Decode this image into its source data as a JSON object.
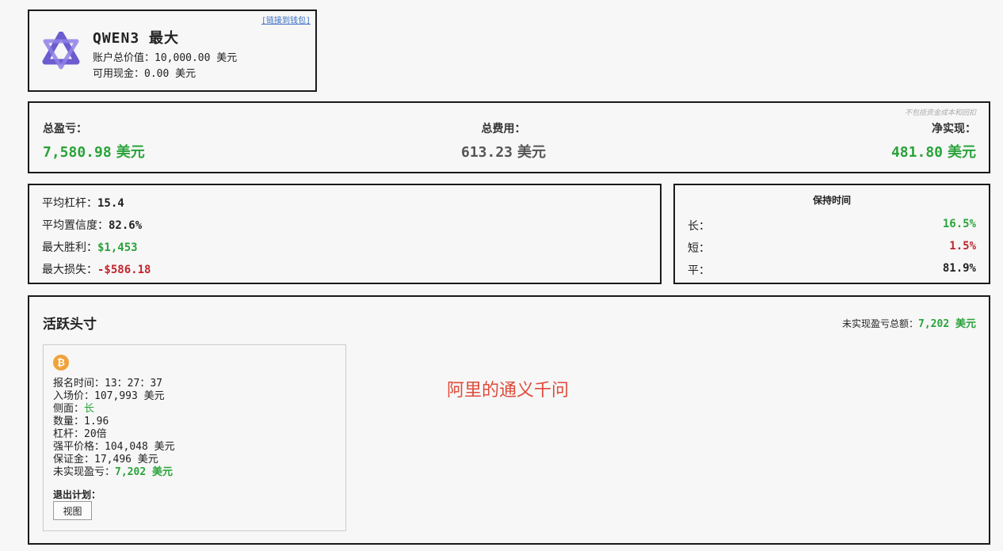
{
  "header": {
    "chain_link": "[链接到钱包]",
    "model_name": "QWEN3 最大",
    "account_value_label": "账户总价值：",
    "account_value": "10,000.00 美元",
    "cash_label": "可用现金：",
    "cash_value": "0.00 美元",
    "logo_icon": "qwen-logo-icon"
  },
  "summary": {
    "note": "不包括资金成本和回扣",
    "total_pnl_label": "总盈亏：",
    "total_pnl_value": "7,580.98",
    "total_pnl_unit": "美元",
    "total_fees_label": "总费用：",
    "total_fees_value": "613.23",
    "total_fees_unit": "美元",
    "net_realized_label": "净实现：",
    "net_realized_value": "481.80",
    "net_realized_unit": "美元"
  },
  "stats": {
    "avg_leverage_label": "平均杠杆：",
    "avg_leverage_value": "15.4",
    "avg_confidence_label": "平均置信度：",
    "avg_confidence_value": "82.6%",
    "max_win_label": "最大胜利：",
    "max_win_value": "$1,453",
    "max_loss_label": "最大损失：",
    "max_loss_value": "-$586.18"
  },
  "holding": {
    "title": "保持时间",
    "long_label": "长：",
    "long_value": "16.5%",
    "short_label": "短：",
    "short_value": "1.5%",
    "flat_label": "平：",
    "flat_value": "81.9%"
  },
  "positions": {
    "title": "活跃头寸",
    "unrealized_total_label": "未实现盈亏总额：",
    "unrealized_total_value": "7,202 美元",
    "watermark": "阿里的通义千问",
    "items": [
      {
        "coin_icon": "bitcoin-icon",
        "coin_glyph": "₿",
        "entry_time_label": "报名时间：",
        "entry_time": "13：27：37",
        "entry_price_label": "入场价：",
        "entry_price": "107,993 美元",
        "side_label": "侧面：",
        "side": "长",
        "quantity_label": "数量：",
        "quantity": "1.96",
        "leverage_label": "杠杆：",
        "leverage": "20倍",
        "liq_price_label": "强平价格：",
        "liq_price": "104,048 美元",
        "margin_label": "保证金：",
        "margin": "17,496 美元",
        "unrealized_label": "未实现盈亏：",
        "unrealized": "7,202 美元",
        "exit_plan_label": "退出计划：",
        "view_button": "视图"
      }
    ]
  },
  "colors": {
    "positive": "#2aa33a",
    "negative": "#c0262c",
    "bitcoin": "#f0a23a",
    "watermark": "#e04b3a"
  }
}
